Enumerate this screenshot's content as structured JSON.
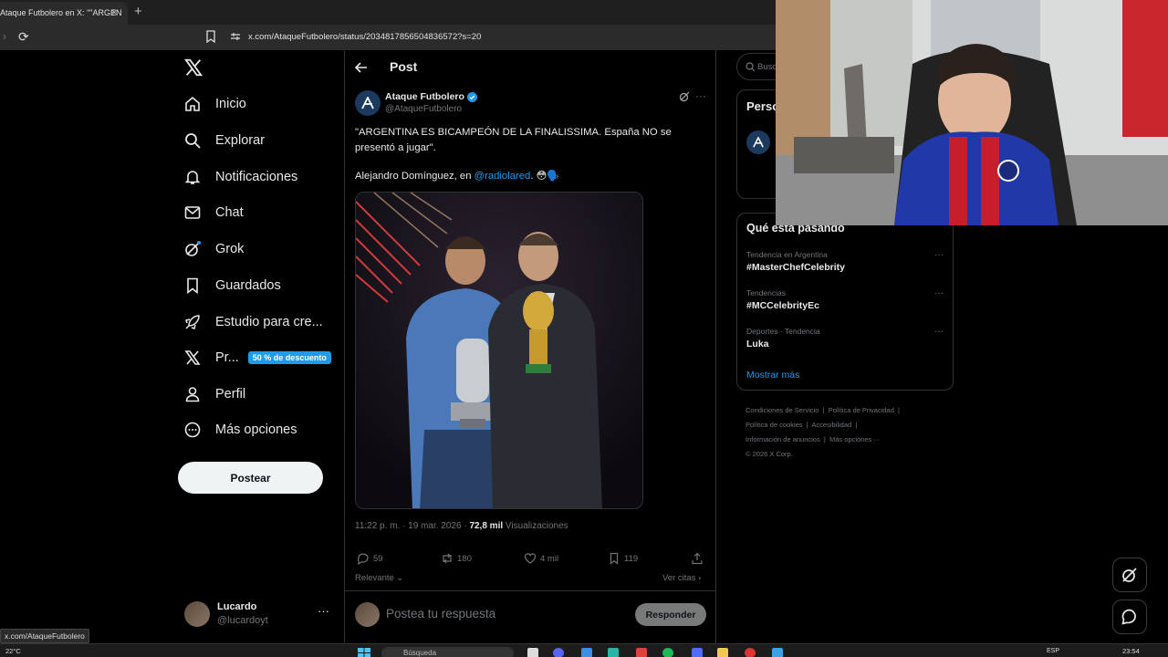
{
  "browser": {
    "tab_title": "Ataque Futbolero en X: \"\"ARGEN",
    "tab_close": "×",
    "new_tab": "+",
    "url": "x.com/AtaqueFutbolero/status/2034817856504836572?s=20",
    "status_url": "x.com/AtaqueFutbolero"
  },
  "sidebar": {
    "items": [
      {
        "label": "Inicio",
        "icon": "home-icon"
      },
      {
        "label": "Explorar",
        "icon": "search-icon"
      },
      {
        "label": "Notificaciones",
        "icon": "bell-icon"
      },
      {
        "label": "Chat",
        "icon": "mail-icon"
      },
      {
        "label": "Grok",
        "icon": "grok-icon"
      },
      {
        "label": "Guardados",
        "icon": "bookmark-icon"
      },
      {
        "label": "Estudio para cre...",
        "icon": "rocket-icon"
      },
      {
        "label": "Pr...",
        "icon": "x-premium-icon",
        "badge": "50 % de descuento"
      },
      {
        "label": "Perfil",
        "icon": "person-icon"
      },
      {
        "label": "Más opciones",
        "icon": "more-circle-icon"
      }
    ],
    "post_button": "Postear",
    "account": {
      "name": "Lucardo",
      "handle": "@lucardoyt",
      "more": "···"
    }
  },
  "post": {
    "header_title": "Post",
    "author_name": "Ataque Futbolero",
    "author_handle": "@AtaqueFutbolero",
    "more": "···",
    "text_line1": "\"ARGENTINA ES BICAMPEÓN DE LA FINALISSIMA. España NO se presentó a jugar\".",
    "text_line2_prefix": "Alejandro Domínguez, en ",
    "mention": "@radiolared",
    "text_line2_suffix": ". 😳🗣️",
    "meta_time": "11:22 p. m. · 19 mar. 2026 · ",
    "meta_views_count": "72,8 mil",
    "meta_views_label": " Visualizaciones",
    "stats": {
      "replies": "59",
      "reposts": "180",
      "likes": "4 mil",
      "bookmarks": "119"
    },
    "sort_label": "Relevante",
    "quotes_label": "Ver citas",
    "reply_placeholder": "Postea tu respuesta",
    "reply_button": "Responder"
  },
  "right": {
    "search_placeholder": "Busc",
    "card_title": "Perso",
    "trends_title": "Qué está pasando",
    "trends": [
      {
        "context": "Tendencia en Argentina",
        "name": "#MasterChefCelebrity"
      },
      {
        "context": "Tendencias",
        "name": "#MCCelebrityEc"
      },
      {
        "context": "Deportes · Tendencia",
        "name": "Luka"
      }
    ],
    "trend_more": "···",
    "show_more": "Mostrar más",
    "footer": {
      "l1": "Condiciones de Servicio",
      "l2": "Política de Privacidad",
      "l3": "Política de cookies",
      "l4": "Accesibilidad",
      "l5": "Información de anuncios",
      "l6": "Más opciones ···",
      "l7": "© 2026 X Corp."
    }
  },
  "taskbar": {
    "weather": "22°C",
    "search": "Búsqueda",
    "lang": "ESP",
    "time": "23:54"
  },
  "colors": {
    "accent": "#1d9bf0",
    "background": "#000000",
    "border": "#2f3336",
    "muted": "#71767b"
  }
}
